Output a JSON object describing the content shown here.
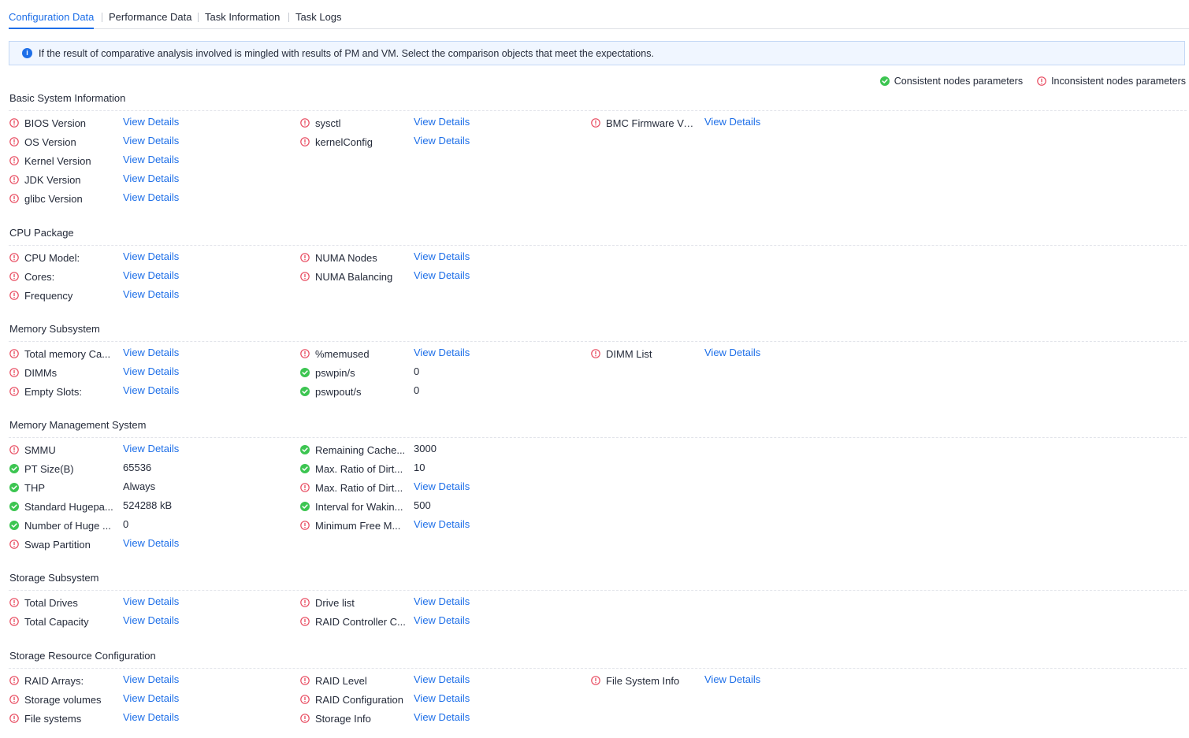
{
  "tabs": [
    {
      "label": "Configuration Data",
      "active": true
    },
    {
      "label": "Performance Data",
      "active": false
    },
    {
      "label": "Task Information",
      "active": false
    },
    {
      "label": "Task Logs",
      "active": false
    }
  ],
  "alert": {
    "icon": "info-icon",
    "text": "If the result of comparative analysis involved is mingled with results of PM and VM. Select the comparison objects that meet the expectations."
  },
  "legend": {
    "consistent": {
      "label": "Consistent nodes parameters",
      "icon": "check-circle-icon",
      "color": "#3cc551"
    },
    "inconsistent": {
      "label": "Inconsistent nodes parameters",
      "icon": "alert-circle-icon",
      "color": "#e84a5f"
    }
  },
  "colors": {
    "accent": "#1e6fe8",
    "consistent": "#3cc551",
    "inconsistent": "#e84a5f"
  },
  "sections": [
    {
      "title": "Basic System Information",
      "columns": [
        [
          {
            "name": "BIOS Version",
            "status": "inconsistent",
            "value": "View Details",
            "link": true
          },
          {
            "name": "OS Version",
            "status": "inconsistent",
            "value": "View Details",
            "link": true
          },
          {
            "name": "Kernel Version",
            "status": "inconsistent",
            "value": "View Details",
            "link": true
          },
          {
            "name": "JDK Version",
            "status": "inconsistent",
            "value": "View Details",
            "link": true
          },
          {
            "name": "glibc Version",
            "status": "inconsistent",
            "value": "View Details",
            "link": true
          }
        ],
        [
          {
            "name": "sysctl",
            "status": "inconsistent",
            "value": "View Details",
            "link": true
          },
          {
            "name": "kernelConfig",
            "status": "inconsistent",
            "value": "View Details",
            "link": true
          }
        ],
        [
          {
            "name": "BMC Firmware Ve...",
            "status": "inconsistent",
            "value": "View Details",
            "link": true
          }
        ]
      ]
    },
    {
      "title": "CPU Package",
      "columns": [
        [
          {
            "name": "CPU Model:",
            "status": "inconsistent",
            "value": "View Details",
            "link": true
          },
          {
            "name": "Cores:",
            "status": "inconsistent",
            "value": "View Details",
            "link": true
          },
          {
            "name": "Frequency",
            "status": "inconsistent",
            "value": "View Details",
            "link": true
          }
        ],
        [
          {
            "name": "NUMA Nodes",
            "status": "inconsistent",
            "value": "View Details",
            "link": true
          },
          {
            "name": "NUMA Balancing",
            "status": "inconsistent",
            "value": "View Details",
            "link": true
          }
        ]
      ]
    },
    {
      "title": "Memory Subsystem",
      "columns": [
        [
          {
            "name": "Total memory Ca...",
            "status": "inconsistent",
            "value": "View Details",
            "link": true
          },
          {
            "name": "DIMMs",
            "status": "inconsistent",
            "value": "View Details",
            "link": true
          },
          {
            "name": "Empty Slots:",
            "status": "inconsistent",
            "value": "View Details",
            "link": true
          }
        ],
        [
          {
            "name": "%memused",
            "status": "inconsistent",
            "value": "View Details",
            "link": true
          },
          {
            "name": "pswpin/s",
            "status": "consistent",
            "value": "0",
            "link": false
          },
          {
            "name": "pswpout/s",
            "status": "consistent",
            "value": "0",
            "link": false
          }
        ],
        [
          {
            "name": "DIMM List",
            "status": "inconsistent",
            "value": "View Details",
            "link": true
          }
        ]
      ]
    },
    {
      "title": "Memory Management System",
      "columns": [
        [
          {
            "name": "SMMU",
            "status": "inconsistent",
            "value": "View Details",
            "link": true
          },
          {
            "name": "PT Size(B)",
            "status": "consistent",
            "value": "65536",
            "link": false
          },
          {
            "name": "THP",
            "status": "consistent",
            "value": "Always",
            "link": false
          },
          {
            "name": "Standard Hugepa...",
            "status": "consistent",
            "value": "524288 kB",
            "link": false
          },
          {
            "name": "Number of Huge ...",
            "status": "consistent",
            "value": "0",
            "link": false
          },
          {
            "name": "Swap Partition",
            "status": "inconsistent",
            "value": "View Details",
            "link": true
          }
        ],
        [
          {
            "name": "Remaining Cache...",
            "status": "consistent",
            "value": "3000",
            "link": false
          },
          {
            "name": "Max. Ratio of Dirt...",
            "status": "consistent",
            "value": "10",
            "link": false
          },
          {
            "name": "Max. Ratio of Dirt...",
            "status": "inconsistent",
            "value": "View Details",
            "link": true
          },
          {
            "name": "Interval for Wakin...",
            "status": "consistent",
            "value": "500",
            "link": false
          },
          {
            "name": "Minimum Free M...",
            "status": "inconsistent",
            "value": "View Details",
            "link": true
          }
        ]
      ]
    },
    {
      "title": "Storage Subsystem",
      "columns": [
        [
          {
            "name": "Total Drives",
            "status": "inconsistent",
            "value": "View Details",
            "link": true
          },
          {
            "name": "Total Capacity",
            "status": "inconsistent",
            "value": "View Details",
            "link": true
          }
        ],
        [
          {
            "name": "Drive list",
            "status": "inconsistent",
            "value": "View Details",
            "link": true
          },
          {
            "name": "RAID Controller C...",
            "status": "inconsistent",
            "value": "View Details",
            "link": true
          }
        ]
      ]
    },
    {
      "title": "Storage Resource Configuration",
      "columns": [
        [
          {
            "name": "RAID Arrays:",
            "status": "inconsistent",
            "value": "View Details",
            "link": true
          },
          {
            "name": "Storage volumes",
            "status": "inconsistent",
            "value": "View Details",
            "link": true
          },
          {
            "name": "File systems",
            "status": "inconsistent",
            "value": "View Details",
            "link": true
          }
        ],
        [
          {
            "name": "RAID Level",
            "status": "inconsistent",
            "value": "View Details",
            "link": true
          },
          {
            "name": "RAID Configuration",
            "status": "inconsistent",
            "value": "View Details",
            "link": true
          },
          {
            "name": "Storage Info",
            "status": "inconsistent",
            "value": "View Details",
            "link": true
          }
        ],
        [
          {
            "name": "File System Info",
            "status": "inconsistent",
            "value": "View Details",
            "link": true
          }
        ]
      ]
    }
  ]
}
